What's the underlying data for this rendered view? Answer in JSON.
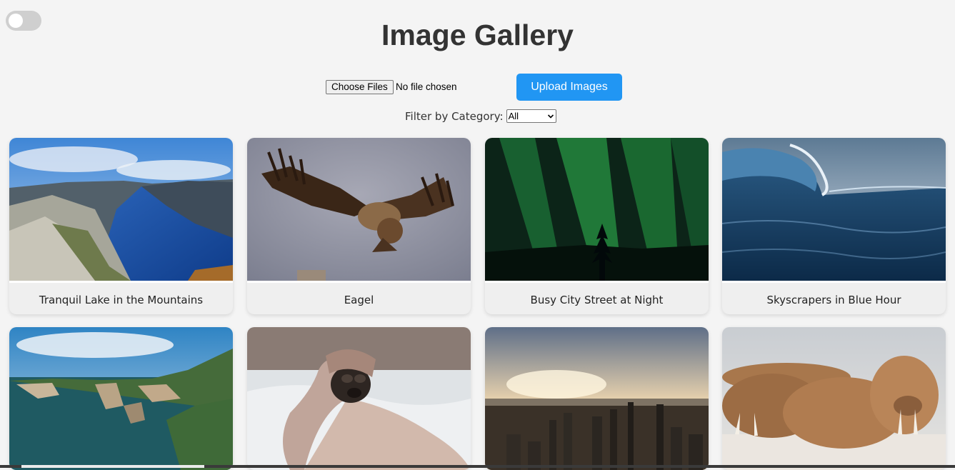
{
  "header": {
    "title": "Image Gallery"
  },
  "theme_toggle": {
    "state": "off"
  },
  "upload": {
    "choose_label": "Choose Files",
    "file_status": "No file chosen",
    "upload_label": "Upload Images"
  },
  "filter": {
    "label": "Filter by Category:",
    "selected": "All"
  },
  "colors": {
    "accent": "#2196f3",
    "background": "#f4f4f4"
  },
  "gallery": {
    "items": [
      {
        "caption": "Tranquil Lake in the Mountains",
        "image": "mountain-fjord"
      },
      {
        "caption": "Eagel",
        "image": "vulture-flying"
      },
      {
        "caption": "Busy City Street at Night",
        "image": "northern-lights"
      },
      {
        "caption": "Skyscrapers in Blue Hour",
        "image": "ocean-wave"
      },
      {
        "caption": "",
        "image": "coastal-cliffs"
      },
      {
        "caption": "",
        "image": "pug-in-blanket"
      },
      {
        "caption": "",
        "image": "city-sunset"
      },
      {
        "caption": "",
        "image": "walruses-on-beach"
      }
    ]
  }
}
